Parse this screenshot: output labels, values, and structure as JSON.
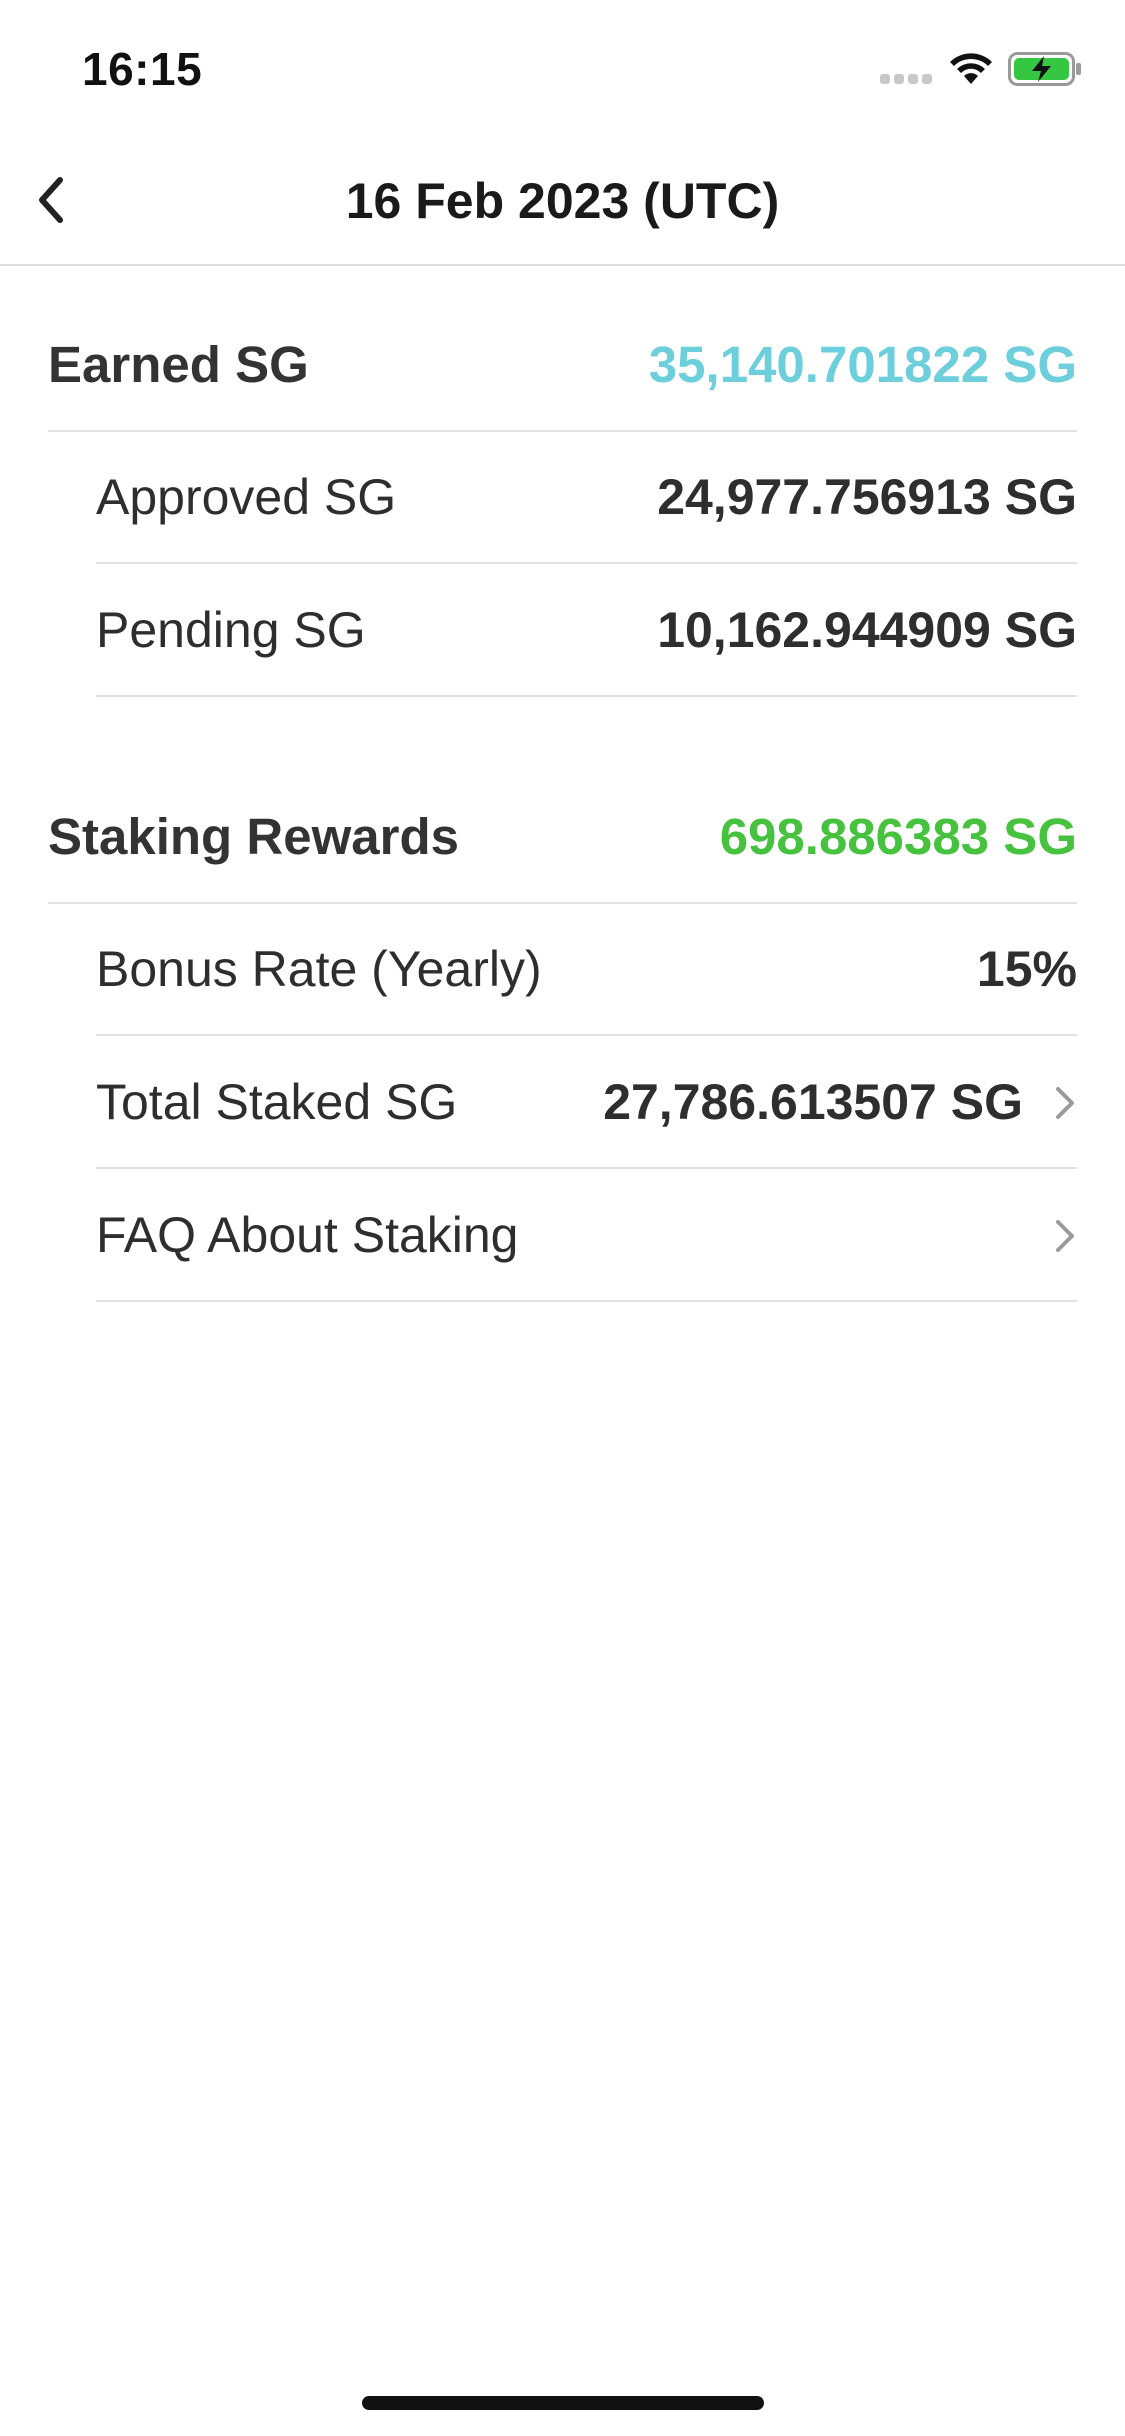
{
  "status_bar": {
    "time": "16:15",
    "icons": [
      "signal-icon",
      "wifi-icon",
      "battery-charging-icon"
    ],
    "battery_color": "#35c742"
  },
  "nav": {
    "title": "16 Feb 2023 (UTC)",
    "back_icon": "chevron-left-icon"
  },
  "earned": {
    "label": "Earned SG",
    "value": "35,140.701822 SG",
    "value_color": "#6ccfdb",
    "items": [
      {
        "label": "Approved SG",
        "value": "24,977.756913 SG"
      },
      {
        "label": "Pending SG",
        "value": "10,162.944909 SG"
      }
    ]
  },
  "staking": {
    "label": "Staking Rewards",
    "value": "698.886383 SG",
    "value_color": "#47c23f",
    "items": [
      {
        "label": "Bonus Rate (Yearly)",
        "value": "15%"
      },
      {
        "label": "Total Staked SG",
        "value": "27,786.613507 SG",
        "icon": "chevron-right-icon"
      },
      {
        "label": "FAQ About Staking",
        "icon": "chevron-right-icon"
      }
    ]
  }
}
